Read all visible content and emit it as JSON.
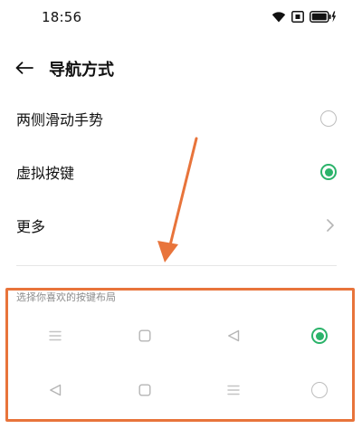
{
  "status_bar": {
    "time": "18:56",
    "icons": [
      "wifi-icon",
      "nfc-icon",
      "battery-charging-icon"
    ]
  },
  "header": {
    "back_icon": "arrow-left-icon",
    "title": "导航方式"
  },
  "options": [
    {
      "label": "两侧滑动手势",
      "selected": false
    },
    {
      "label": "虚拟按键",
      "selected": true
    }
  ],
  "more": {
    "label": "更多",
    "icon": "chevron-right-icon"
  },
  "layout_section": {
    "title": "选择你喜欢的按键布局",
    "layouts": [
      {
        "icons": [
          "menu-icon",
          "home-square-icon",
          "back-triangle-icon"
        ],
        "selected": true
      },
      {
        "icons": [
          "back-triangle-icon",
          "home-square-icon",
          "menu-icon"
        ],
        "selected": false
      }
    ]
  },
  "colors": {
    "accent_green": "#2bb36a",
    "annotation_orange": "#e8743b",
    "divider": "#e6e6e6",
    "muted_icon": "#c4c4c4"
  }
}
